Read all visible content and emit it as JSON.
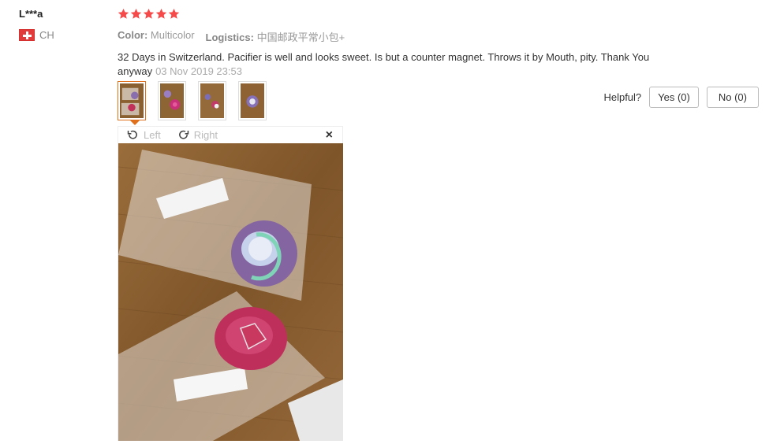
{
  "user": {
    "name": "L***a",
    "country": "CH"
  },
  "rating": {
    "stars": 5,
    "max": 5
  },
  "meta": {
    "color_label": "Color:",
    "color_value": "Multicolor",
    "logistics_label": "Logistics:",
    "logistics_value": "中国邮政平常小包+"
  },
  "review": {
    "text": "32 Days in Switzerland. Pacifier is well and looks sweet. Is but a counter magnet. Throws it by Mouth, pity. Thank You anyway",
    "date": "03 Nov 2019 23:53"
  },
  "helpful": {
    "label": "Helpful?",
    "yes": "Yes (0)",
    "no": "No (0)"
  },
  "viewer": {
    "left_label": "Left",
    "right_label": "Right",
    "close": "×"
  },
  "thumbnails": [
    {
      "name": "thumb-1",
      "active": true
    },
    {
      "name": "thumb-2",
      "active": false
    },
    {
      "name": "thumb-3",
      "active": false
    },
    {
      "name": "thumb-4",
      "active": false
    }
  ],
  "colors": {
    "star": "#f5494a",
    "accent": "#e0701b",
    "wood": "#8a6030"
  },
  "icons": [
    "star-icon",
    "swiss-flag-icon",
    "rotate-left-icon",
    "rotate-right-icon",
    "close-icon"
  ]
}
